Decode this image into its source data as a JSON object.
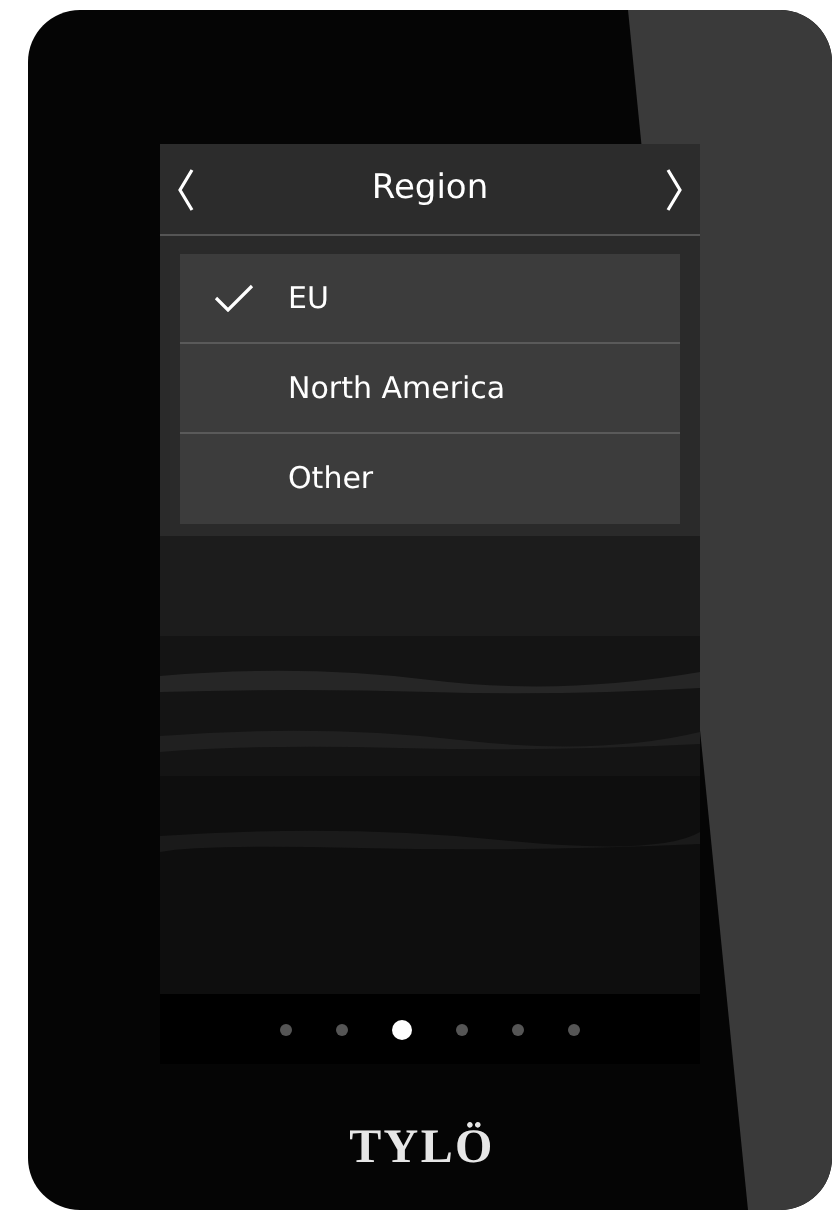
{
  "header": {
    "title": "Region"
  },
  "options": [
    {
      "label": "EU",
      "selected": true
    },
    {
      "label": "North America",
      "selected": false
    },
    {
      "label": "Other",
      "selected": false
    }
  ],
  "pages": [
    {
      "selected": false
    },
    {
      "selected": false
    },
    {
      "selected": true
    },
    {
      "selected": false
    },
    {
      "selected": false
    },
    {
      "selected": false
    }
  ],
  "brand": "TYLÖ"
}
